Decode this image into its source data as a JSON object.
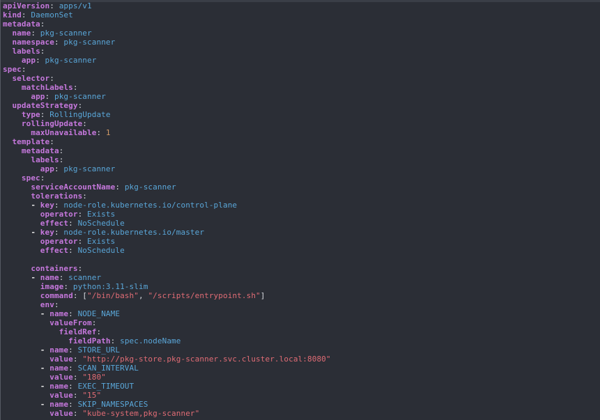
{
  "editor": {
    "lines": [
      [
        {
          "t": "key",
          "v": "apiVersion"
        },
        {
          "t": "colon",
          "v": ": "
        },
        {
          "t": "val",
          "v": "apps/v1"
        }
      ],
      [
        {
          "t": "key",
          "v": "kind"
        },
        {
          "t": "colon",
          "v": ": "
        },
        {
          "t": "val",
          "v": "DaemonSet"
        }
      ],
      [
        {
          "t": "key",
          "v": "metadata"
        },
        {
          "t": "colon",
          "v": ":"
        }
      ],
      [
        {
          "t": "sp",
          "v": "  "
        },
        {
          "t": "key",
          "v": "name"
        },
        {
          "t": "colon",
          "v": ": "
        },
        {
          "t": "val",
          "v": "pkg-scanner"
        }
      ],
      [
        {
          "t": "sp",
          "v": "  "
        },
        {
          "t": "key",
          "v": "namespace"
        },
        {
          "t": "colon",
          "v": ": "
        },
        {
          "t": "val",
          "v": "pkg-scanner"
        }
      ],
      [
        {
          "t": "sp",
          "v": "  "
        },
        {
          "t": "key",
          "v": "labels"
        },
        {
          "t": "colon",
          "v": ":"
        }
      ],
      [
        {
          "t": "sp",
          "v": "    "
        },
        {
          "t": "key",
          "v": "app"
        },
        {
          "t": "colon",
          "v": ": "
        },
        {
          "t": "val",
          "v": "pkg-scanner"
        }
      ],
      [
        {
          "t": "key",
          "v": "spec"
        },
        {
          "t": "colon",
          "v": ":"
        }
      ],
      [
        {
          "t": "sp",
          "v": "  "
        },
        {
          "t": "key",
          "v": "selector"
        },
        {
          "t": "colon",
          "v": ":"
        }
      ],
      [
        {
          "t": "sp",
          "v": "    "
        },
        {
          "t": "key",
          "v": "matchLabels"
        },
        {
          "t": "colon",
          "v": ":"
        }
      ],
      [
        {
          "t": "sp",
          "v": "      "
        },
        {
          "t": "key",
          "v": "app"
        },
        {
          "t": "colon",
          "v": ": "
        },
        {
          "t": "val",
          "v": "pkg-scanner"
        }
      ],
      [
        {
          "t": "sp",
          "v": "  "
        },
        {
          "t": "key",
          "v": "updateStrategy"
        },
        {
          "t": "colon",
          "v": ":"
        }
      ],
      [
        {
          "t": "sp",
          "v": "    "
        },
        {
          "t": "key",
          "v": "type"
        },
        {
          "t": "colon",
          "v": ": "
        },
        {
          "t": "val",
          "v": "RollingUpdate"
        }
      ],
      [
        {
          "t": "sp",
          "v": "    "
        },
        {
          "t": "key",
          "v": "rollingUpdate"
        },
        {
          "t": "colon",
          "v": ":"
        }
      ],
      [
        {
          "t": "sp",
          "v": "      "
        },
        {
          "t": "key",
          "v": "maxUnavailable"
        },
        {
          "t": "colon",
          "v": ": "
        },
        {
          "t": "num",
          "v": "1"
        }
      ],
      [
        {
          "t": "sp",
          "v": "  "
        },
        {
          "t": "key",
          "v": "template"
        },
        {
          "t": "colon",
          "v": ":"
        }
      ],
      [
        {
          "t": "sp",
          "v": "    "
        },
        {
          "t": "key",
          "v": "metadata"
        },
        {
          "t": "colon",
          "v": ":"
        }
      ],
      [
        {
          "t": "sp",
          "v": "      "
        },
        {
          "t": "key",
          "v": "labels"
        },
        {
          "t": "colon",
          "v": ":"
        }
      ],
      [
        {
          "t": "sp",
          "v": "        "
        },
        {
          "t": "key",
          "v": "app"
        },
        {
          "t": "colon",
          "v": ": "
        },
        {
          "t": "val",
          "v": "pkg-scanner"
        }
      ],
      [
        {
          "t": "sp",
          "v": "    "
        },
        {
          "t": "key",
          "v": "spec"
        },
        {
          "t": "colon",
          "v": ":"
        }
      ],
      [
        {
          "t": "sp",
          "v": "      "
        },
        {
          "t": "key",
          "v": "serviceAccountName"
        },
        {
          "t": "colon",
          "v": ": "
        },
        {
          "t": "val",
          "v": "pkg-scanner"
        }
      ],
      [
        {
          "t": "sp",
          "v": "      "
        },
        {
          "t": "key",
          "v": "tolerations"
        },
        {
          "t": "colon",
          "v": ":"
        }
      ],
      [
        {
          "t": "sp",
          "v": "      "
        },
        {
          "t": "dash",
          "v": "- "
        },
        {
          "t": "key",
          "v": "key"
        },
        {
          "t": "colon",
          "v": ": "
        },
        {
          "t": "val",
          "v": "node-role.kubernetes.io/control-plane"
        }
      ],
      [
        {
          "t": "sp",
          "v": "        "
        },
        {
          "t": "key",
          "v": "operator"
        },
        {
          "t": "colon",
          "v": ": "
        },
        {
          "t": "val",
          "v": "Exists"
        }
      ],
      [
        {
          "t": "sp",
          "v": "        "
        },
        {
          "t": "key",
          "v": "effect"
        },
        {
          "t": "colon",
          "v": ": "
        },
        {
          "t": "val",
          "v": "NoSchedule"
        }
      ],
      [
        {
          "t": "sp",
          "v": "      "
        },
        {
          "t": "dash",
          "v": "- "
        },
        {
          "t": "key",
          "v": "key"
        },
        {
          "t": "colon",
          "v": ": "
        },
        {
          "t": "val",
          "v": "node-role.kubernetes.io/master"
        }
      ],
      [
        {
          "t": "sp",
          "v": "        "
        },
        {
          "t": "key",
          "v": "operator"
        },
        {
          "t": "colon",
          "v": ": "
        },
        {
          "t": "val",
          "v": "Exists"
        }
      ],
      [
        {
          "t": "sp",
          "v": "        "
        },
        {
          "t": "key",
          "v": "effect"
        },
        {
          "t": "colon",
          "v": ": "
        },
        {
          "t": "val",
          "v": "NoSchedule"
        }
      ],
      [],
      [
        {
          "t": "sp",
          "v": "      "
        },
        {
          "t": "key",
          "v": "containers"
        },
        {
          "t": "colon",
          "v": ":"
        }
      ],
      [
        {
          "t": "sp",
          "v": "      "
        },
        {
          "t": "dash",
          "v": "- "
        },
        {
          "t": "key",
          "v": "name"
        },
        {
          "t": "colon",
          "v": ": "
        },
        {
          "t": "val",
          "v": "scanner"
        }
      ],
      [
        {
          "t": "sp",
          "v": "        "
        },
        {
          "t": "key",
          "v": "image"
        },
        {
          "t": "colon",
          "v": ": "
        },
        {
          "t": "val",
          "v": "python:3.11-slim"
        }
      ],
      [
        {
          "t": "sp",
          "v": "        "
        },
        {
          "t": "key",
          "v": "command"
        },
        {
          "t": "colon",
          "v": ": "
        },
        {
          "t": "punc",
          "v": "["
        },
        {
          "t": "str",
          "v": "\"/bin/bash\""
        },
        {
          "t": "punc",
          "v": ", "
        },
        {
          "t": "str",
          "v": "\"/scripts/entrypoint.sh\""
        },
        {
          "t": "punc",
          "v": "]"
        }
      ],
      [
        {
          "t": "sp",
          "v": "        "
        },
        {
          "t": "key",
          "v": "env"
        },
        {
          "t": "colon",
          "v": ":"
        }
      ],
      [
        {
          "t": "sp",
          "v": "        "
        },
        {
          "t": "dash",
          "v": "- "
        },
        {
          "t": "key",
          "v": "name"
        },
        {
          "t": "colon",
          "v": ": "
        },
        {
          "t": "val",
          "v": "NODE_NAME"
        }
      ],
      [
        {
          "t": "sp",
          "v": "          "
        },
        {
          "t": "key",
          "v": "valueFrom"
        },
        {
          "t": "colon",
          "v": ":"
        }
      ],
      [
        {
          "t": "sp",
          "v": "            "
        },
        {
          "t": "key",
          "v": "fieldRef"
        },
        {
          "t": "colon",
          "v": ":"
        }
      ],
      [
        {
          "t": "sp",
          "v": "              "
        },
        {
          "t": "key",
          "v": "fieldPath"
        },
        {
          "t": "colon",
          "v": ": "
        },
        {
          "t": "val",
          "v": "spec.nodeName"
        }
      ],
      [
        {
          "t": "sp",
          "v": "        "
        },
        {
          "t": "dash",
          "v": "- "
        },
        {
          "t": "key",
          "v": "name"
        },
        {
          "t": "colon",
          "v": ": "
        },
        {
          "t": "val",
          "v": "STORE_URL"
        }
      ],
      [
        {
          "t": "sp",
          "v": "          "
        },
        {
          "t": "key",
          "v": "value"
        },
        {
          "t": "colon",
          "v": ": "
        },
        {
          "t": "str",
          "v": "\"http://pkg-store.pkg-scanner.svc.cluster.local:8080\""
        }
      ],
      [
        {
          "t": "sp",
          "v": "        "
        },
        {
          "t": "dash",
          "v": "- "
        },
        {
          "t": "key",
          "v": "name"
        },
        {
          "t": "colon",
          "v": ": "
        },
        {
          "t": "val",
          "v": "SCAN_INTERVAL"
        }
      ],
      [
        {
          "t": "sp",
          "v": "          "
        },
        {
          "t": "key",
          "v": "value"
        },
        {
          "t": "colon",
          "v": ": "
        },
        {
          "t": "str",
          "v": "\"180\""
        }
      ],
      [
        {
          "t": "sp",
          "v": "        "
        },
        {
          "t": "dash",
          "v": "- "
        },
        {
          "t": "key",
          "v": "name"
        },
        {
          "t": "colon",
          "v": ": "
        },
        {
          "t": "val",
          "v": "EXEC_TIMEOUT"
        }
      ],
      [
        {
          "t": "sp",
          "v": "          "
        },
        {
          "t": "key",
          "v": "value"
        },
        {
          "t": "colon",
          "v": ": "
        },
        {
          "t": "str",
          "v": "\"15\""
        }
      ],
      [
        {
          "t": "sp",
          "v": "        "
        },
        {
          "t": "dash",
          "v": "- "
        },
        {
          "t": "key",
          "v": "name"
        },
        {
          "t": "colon",
          "v": ": "
        },
        {
          "t": "val",
          "v": "SKIP_NAMESPACES"
        }
      ],
      [
        {
          "t": "sp",
          "v": "          "
        },
        {
          "t": "key",
          "v": "value"
        },
        {
          "t": "colon",
          "v": ": "
        },
        {
          "t": "str",
          "v": "\"kube-system,pkg-scanner\""
        }
      ]
    ]
  },
  "colors": {
    "background": "#2b2e36",
    "key": "#c678dd",
    "value": "#5aa7d9",
    "string": "#e06c75",
    "number": "#d19a66"
  }
}
